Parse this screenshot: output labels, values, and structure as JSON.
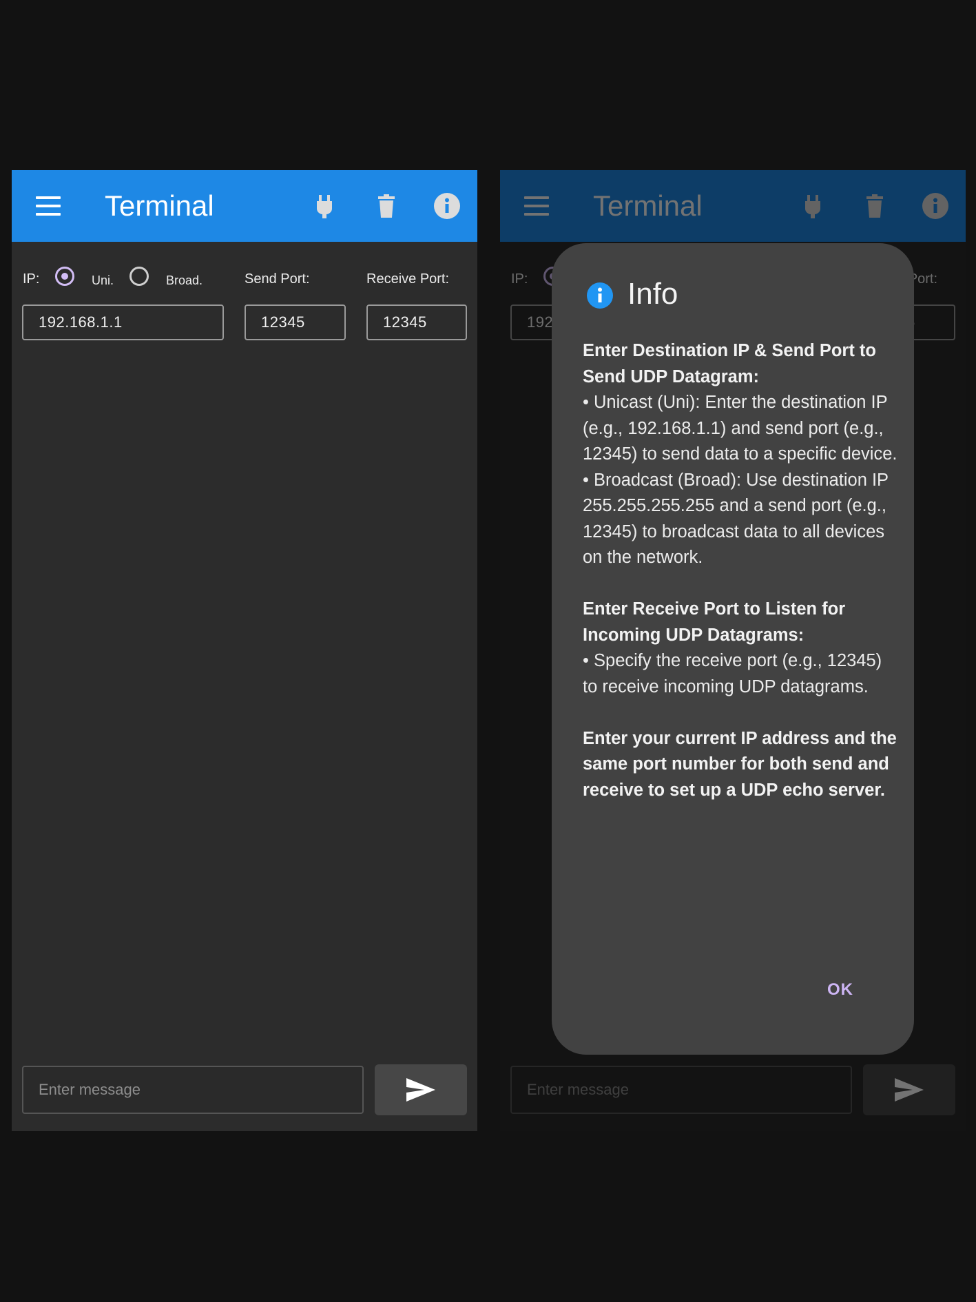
{
  "appbar": {
    "title": "Terminal"
  },
  "settings": {
    "ip_label": "IP:",
    "unicast_label": "Uni.",
    "broadcast_label": "Broad.",
    "send_port_label": "Send Port:",
    "receive_port_label": "Receive Port:",
    "ip_value": "192.168.1.1",
    "send_port_value": "12345",
    "receive_port_value": "12345",
    "selected_mode": "Uni."
  },
  "composer": {
    "placeholder": "Enter message"
  },
  "dialog": {
    "title": "Info",
    "section1_heading": "Enter Destination IP & Send Port to Send UDP Datagram:",
    "section1_unicast": "• Unicast (Uni): Enter the destination IP (e.g., 192.168.1.1) and send port (e.g., 12345) to send data to a specific device.",
    "section1_broadcast": "• Broadcast (Broad): Use destination IP 255.255.255.255 and a send port (e.g., 12345) to broadcast data to all devices on the network.",
    "section2_heading": "Enter Receive Port to Listen for Incoming UDP Datagrams:",
    "section2_body": "• Specify the receive port (e.g., 12345) to receive incoming UDP datagrams.",
    "section3_heading": "Enter your current IP address and the same port number for both send and receive to set up a UDP echo server.",
    "ok_label": "OK"
  },
  "icons": [
    "menu-icon",
    "plug-icon",
    "trash-icon",
    "info-icon",
    "send-icon"
  ],
  "colors": {
    "appbar": "#1e88e5",
    "accent": "#d2bdf5",
    "dialog_bg": "#424242",
    "background": "#121212"
  }
}
